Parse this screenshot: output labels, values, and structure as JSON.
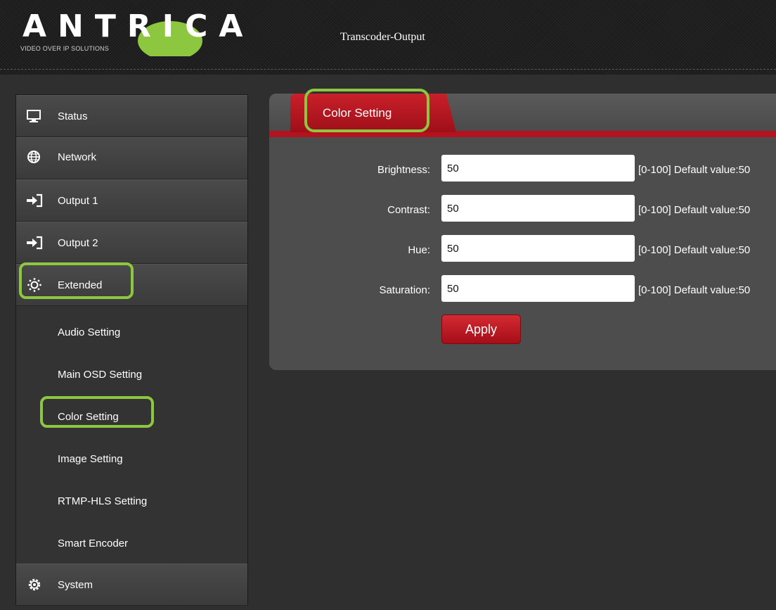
{
  "header": {
    "logo_text": "ANTRICA",
    "logo_tagline": "VIDEO OVER IP SOLUTIONS",
    "title": "Transcoder-Output"
  },
  "sidebar": {
    "items": [
      {
        "label": "Status",
        "icon": "monitor-icon"
      },
      {
        "label": "Network",
        "icon": "globe-icon"
      },
      {
        "label": "Output 1",
        "icon": "sign-in-icon"
      },
      {
        "label": "Output 2",
        "icon": "sign-in-icon"
      },
      {
        "label": "Extended",
        "icon": "gear-dots-icon"
      }
    ],
    "subitems": [
      {
        "label": "Audio Setting"
      },
      {
        "label": "Main OSD Setting"
      },
      {
        "label": "Color Setting"
      },
      {
        "label": "Image Setting"
      },
      {
        "label": "RTMP-HLS Setting"
      },
      {
        "label": "Smart Encoder"
      }
    ],
    "system": {
      "label": "System",
      "icon": "cog-icon"
    }
  },
  "main": {
    "tab_label": "Color Setting",
    "fields": [
      {
        "label": "Brightness:",
        "value": "50",
        "hint": "[0-100] Default value:50"
      },
      {
        "label": "Contrast:",
        "value": "50",
        "hint": "[0-100] Default value:50"
      },
      {
        "label": "Hue:",
        "value": "50",
        "hint": "[0-100] Default value:50"
      },
      {
        "label": "Saturation:",
        "value": "50",
        "hint": "[0-100] Default value:50"
      }
    ],
    "apply_label": "Apply"
  },
  "colors": {
    "accent_red": "#b3121e",
    "highlight_green": "#8dc63f",
    "logo_green": "#8dc63f"
  }
}
